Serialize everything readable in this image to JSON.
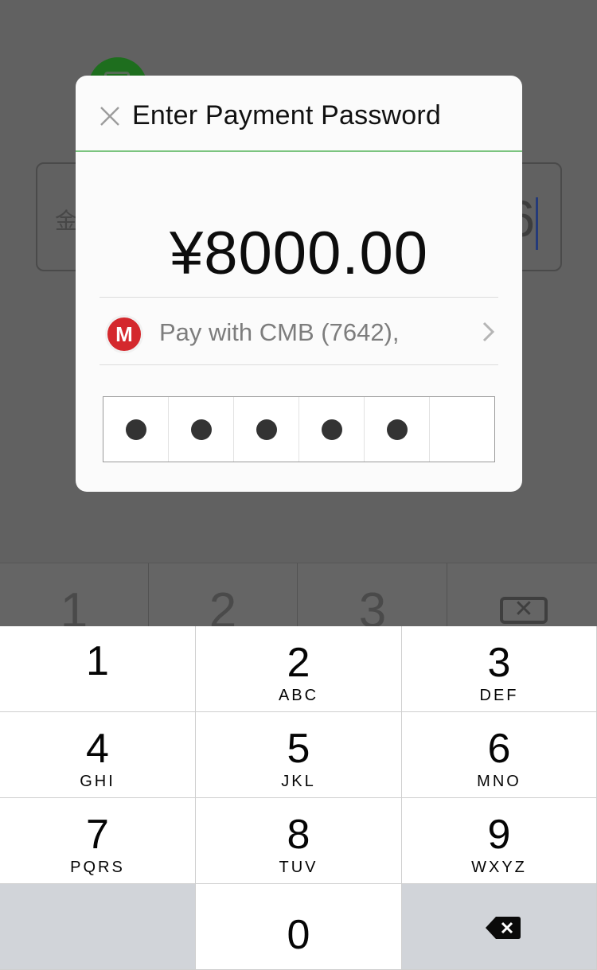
{
  "background": {
    "field_label": "金",
    "field_amount": "6",
    "keys": [
      "1",
      "2",
      "3"
    ]
  },
  "dialog": {
    "title": "Enter Payment Password",
    "amount": "¥8000.00",
    "payment_method": "Pay with CMB (7642),",
    "bank_logo_text": "M",
    "pin_length": 6,
    "pin_filled": 5
  },
  "keypad": {
    "keys": [
      {
        "digit": "1",
        "letters": ""
      },
      {
        "digit": "2",
        "letters": "ABC"
      },
      {
        "digit": "3",
        "letters": "DEF"
      },
      {
        "digit": "4",
        "letters": "GHI"
      },
      {
        "digit": "5",
        "letters": "JKL"
      },
      {
        "digit": "6",
        "letters": "MNO"
      },
      {
        "digit": "7",
        "letters": "PQRS"
      },
      {
        "digit": "8",
        "letters": "TUV"
      },
      {
        "digit": "9",
        "letters": "WXYZ"
      },
      {
        "digit": "0",
        "letters": ""
      }
    ]
  },
  "icons": [
    "close-icon",
    "chevron-right-icon",
    "backspace-icon",
    "bank-logo"
  ],
  "colors": {
    "overlay": "#616161",
    "accent_line": "#7bc47f",
    "bank_red": "#d4282d",
    "keypad_gray": "#d1d4d9"
  }
}
